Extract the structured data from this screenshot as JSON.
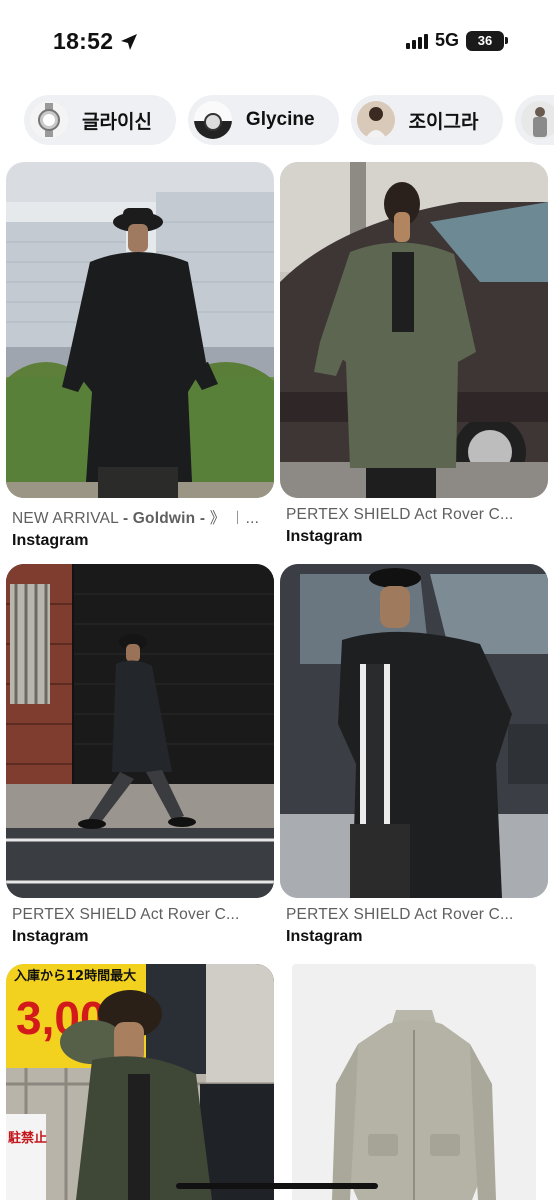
{
  "status": {
    "time": "18:52",
    "network": "5G",
    "battery": "36"
  },
  "chips": [
    {
      "label": "글라이신",
      "thumb": "watch"
    },
    {
      "label": "Glycine",
      "thumb": "watch-dark"
    },
    {
      "label": "조이그라",
      "thumb": "person"
    },
    {
      "label": "",
      "thumb": "person-grey"
    }
  ],
  "pins": [
    {
      "title_start": "NEW ARRIVAL ",
      "title_bold": "- Goldwin -",
      "title_end": " 》 ︱...",
      "source": "Instagram"
    },
    {
      "title": "PERTEX SHIELD Act Rover C...",
      "source": "Instagram"
    },
    {
      "title": "PERTEX SHIELD Act Rover C...",
      "source": "Instagram"
    },
    {
      "title": "PERTEX SHIELD Act Rover C...",
      "source": "Instagram"
    },
    {
      "sign_text": "入庫から12時間最大",
      "sign_price": "3,00",
      "sign_side": "駐禁止"
    }
  ]
}
